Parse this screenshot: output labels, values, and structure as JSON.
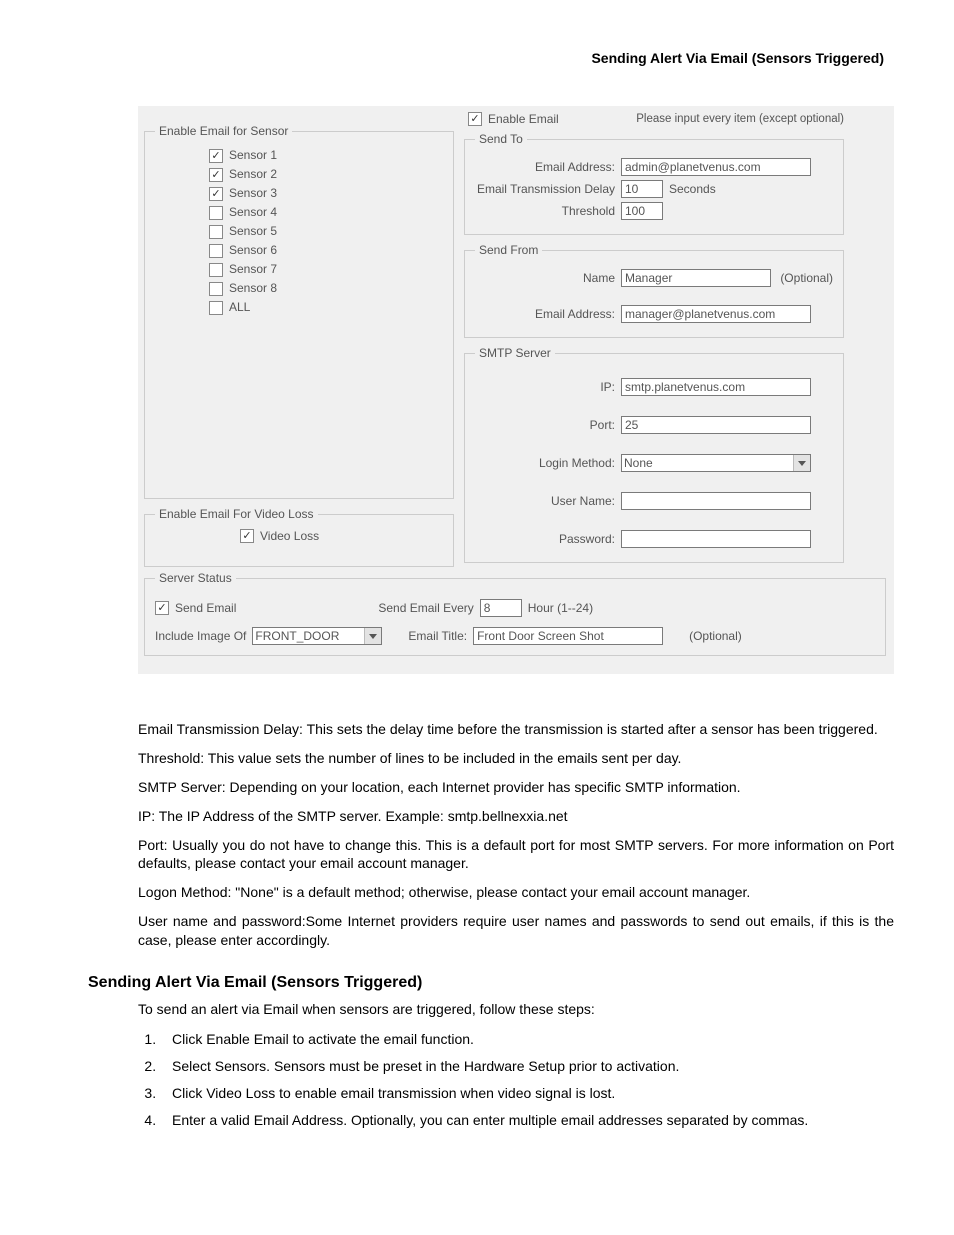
{
  "header": {
    "title": "Sending Alert Via Email (Sensors Triggered)"
  },
  "dialog": {
    "enable_sensor_legend": "Enable Email for Sensor",
    "sensors": [
      {
        "label": "Sensor 1",
        "checked": true
      },
      {
        "label": "Sensor 2",
        "checked": true
      },
      {
        "label": "Sensor 3",
        "checked": true
      },
      {
        "label": "Sensor 4",
        "checked": false
      },
      {
        "label": "Sensor 5",
        "checked": false
      },
      {
        "label": "Sensor 6",
        "checked": false
      },
      {
        "label": "Sensor 7",
        "checked": false
      },
      {
        "label": "Sensor 8",
        "checked": false
      },
      {
        "label": "ALL",
        "checked": false
      }
    ],
    "video_loss_legend": "Enable Email For Video Loss",
    "video_loss_label": "Video Loss",
    "video_loss_checked": true,
    "enable_email_label": "Enable Email",
    "enable_email_checked": true,
    "hint": "Please input every item (except optional)",
    "send_to": {
      "legend": "Send To",
      "email_label": "Email Address:",
      "email_value": "admin@planetvenus.com",
      "delay_label": "Email Transmission Delay",
      "delay_value": "10",
      "delay_unit": "Seconds",
      "threshold_label": "Threshold",
      "threshold_value": "100"
    },
    "send_from": {
      "legend": "Send From",
      "name_label": "Name",
      "name_value": "Manager",
      "name_optional": "(Optional)",
      "email_label": "Email Address:",
      "email_value": "manager@planetvenus.com"
    },
    "smtp": {
      "legend": "SMTP Server",
      "ip_label": "IP:",
      "ip_value": "smtp.planetvenus.com",
      "port_label": "Port:",
      "port_value": "25",
      "login_label": "Login Method:",
      "login_value": "None",
      "user_label": "User Name:",
      "user_value": "",
      "pass_label": "Password:",
      "pass_value": ""
    },
    "status": {
      "legend": "Server Status",
      "send_email_label": "Send Email",
      "send_email_checked": true,
      "every_label": "Send Email Every",
      "every_value": "8",
      "every_unit": "Hour (1--24)",
      "include_label": "Include Image Of",
      "include_value": "FRONT_DOOR",
      "title_label": "Email Title:",
      "title_value": "Front Door Screen Shot",
      "title_optional": "(Optional)"
    }
  },
  "paragraphs": {
    "p1": "Email Transmission Delay: This sets the delay time before the transmission is started after a sensor has been triggered.",
    "p2": "Threshold: This value sets the number of lines to be included in the emails sent per day.",
    "p3": "SMTP Server: Depending on your location, each Internet provider has specific SMTP information.",
    "p4": "IP: The IP Address of the SMTP server. Example: smtp.bellnexxia.net",
    "p5": "Port: Usually you do not have to change this. This is a default port for most SMTP servers. For more information on Port defaults, please contact your email account manager.",
    "p6": "Logon Method: \"None\" is a default method; otherwise, please contact your email account manager.",
    "p7": "User name and password:Some Internet providers require user names and passwords to send out emails, if this is the case, please enter accordingly."
  },
  "section": {
    "heading": "Sending Alert Via Email (Sensors Triggered)",
    "intro": "To send an alert via Email when sensors are triggered, follow these steps:",
    "steps": [
      "Click Enable Email to activate the email function.",
      "Select Sensors. Sensors must be preset in the Hardware Setup prior to activation.",
      "Click Video Loss to enable email transmission when video signal is lost.",
      "Enter a valid Email Address. Optionally, you can enter multiple email addresses separated by commas."
    ]
  }
}
